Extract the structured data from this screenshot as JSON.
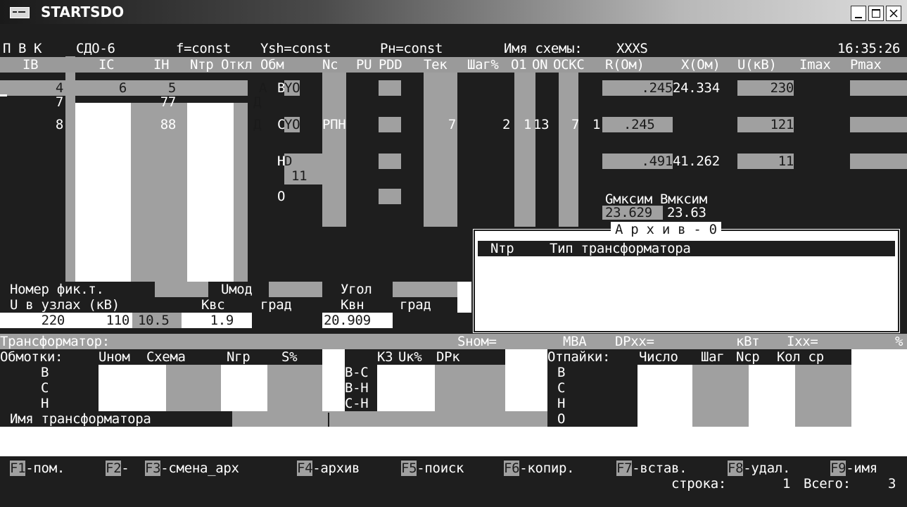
{
  "window": {
    "title": "STARTSDO"
  },
  "status": {
    "p": "П",
    "v": "В",
    "k": "К",
    "model": "СДО-6",
    "f": "f=const",
    "ysh": "Ysh=const",
    "ph": "Рн=const",
    "scheme_label": "Имя схемы:",
    "scheme_name": "XXXS",
    "time": "16:35:26"
  },
  "headers": {
    "ib": "IВ",
    "ic": "IС",
    "ih": "IН",
    "ntp": "Nтр",
    "otkl": "Откл",
    "obm": "Обм",
    "nc": "Nc",
    "pu": "PU",
    "pdd": "PDD",
    "tek": "Тек",
    "shag": "Шаг%",
    "o1": "O1",
    "on": "ON",
    "ockc": "OCKC",
    "r": "R(Ом)",
    "x": "X(Ом)",
    "u": "U(кВ)",
    "imax": "Imax",
    "pmax": "Pmax"
  },
  "rows": [
    {
      "ib": "4",
      "ic": "6",
      "ih": "5",
      "otkl": "A",
      "obm": "B",
      "y": "YO",
      "nc": "",
      "tek": "",
      "shag": "",
      "o1": "",
      "on": "",
      "ockc": "",
      "r": ".245",
      "x": "24.334",
      "u": "230"
    },
    {
      "ib": "7",
      "ic": "",
      "ih": "77",
      "otkl": "Д",
      "obm": "",
      "y": "",
      "nc": "",
      "tek": "",
      "shag": "",
      "o1": "",
      "on": "",
      "ockc": "",
      "r": "",
      "x": "",
      "u": ""
    },
    {
      "ib": "8",
      "ic": "",
      "ih": "88",
      "otkl": "Д",
      "obm": "C",
      "y": "YO",
      "nc": "РПН",
      "tek": "7",
      "shag": "2",
      "o1": "1",
      "on": "13",
      "ockc": "7",
      "ockc2": "1",
      "r": ".245",
      "x": "",
      "u": "121"
    },
    {
      "ib": "",
      "ic": "",
      "ih": "",
      "otkl": "",
      "obm": "H",
      "y": "D",
      "y2": "11",
      "nc": "",
      "tek": "",
      "shag": "",
      "o1": "",
      "on": "",
      "ockc": "",
      "r": ".491",
      "x": "41.262",
      "u": "11"
    },
    {
      "ib": "",
      "ic": "",
      "ih": "",
      "otkl": "",
      "obm": "O",
      "y": "",
      "nc": "",
      "tek": "",
      "shag": "",
      "o1": "",
      "on": "",
      "ockc": "",
      "r": "",
      "x": "",
      "u": ""
    }
  ],
  "g_b": {
    "g_label": "Gмксим",
    "b_label": "Вмксим",
    "g_value": "23.629",
    "b_value": "23.63"
  },
  "archive": {
    "title": "А р х и в - 0",
    "col_ntr": "Nтр",
    "col_type": "Тип трансформатора"
  },
  "fix": {
    "nomer_label": "Номер фик.т.",
    "umod_label": "Uмод",
    "ugol_label": "Угол",
    "u_label": "U в узлах (кВ)",
    "kvs_label": "Квс",
    "grad1": "град",
    "kvn_label": "Квн",
    "grad2": "град",
    "u1": "220",
    "u2": "110",
    "u3": "10.5",
    "kvs": "1.9",
    "kvn": "20.909"
  },
  "trans": {
    "label": "Трансформатор:",
    "shom": "Sном=",
    "mva": "МВА",
    "dpxx": "DPxx=",
    "kvt": "кВт",
    "ixx": "Ixx=",
    "pct": "%",
    "obmotki": "Обмотки:",
    "unom": "Uном",
    "schema": "Схема",
    "ngr": "Nгр",
    "spct": "S%",
    "kz": "КЗ",
    "ukpct": "Uк%",
    "dpk": "DPк",
    "otpaiki": "Отпайки:",
    "chislo": "Число",
    "shag": "Шаг",
    "ncp": "Nср",
    "kolcp": "Кол ср",
    "windings": [
      "В",
      "С",
      "Н"
    ],
    "kz_rows": [
      "В-С",
      "В-Н",
      "С-Н"
    ],
    "tap_rows": [
      "В",
      "С",
      "Н",
      "О"
    ],
    "name_label": "Имя трансформатора"
  },
  "fkeys": [
    {
      "key": "F1",
      "label": "-пом."
    },
    {
      "key": "F2",
      "label": "-"
    },
    {
      "key": "F3",
      "label": "-смена_арх"
    },
    {
      "key": "F4",
      "label": "-архив"
    },
    {
      "key": "F5",
      "label": "-поиск"
    },
    {
      "key": "F6",
      "label": "-копир."
    },
    {
      "key": "F7",
      "label": "-встав."
    },
    {
      "key": "F8",
      "label": "-удал."
    },
    {
      "key": "F9",
      "label": "-имя"
    }
  ],
  "footer": {
    "row_label": "строка:",
    "row_value": "1",
    "total_label": "Всего:",
    "total_value": "3"
  }
}
